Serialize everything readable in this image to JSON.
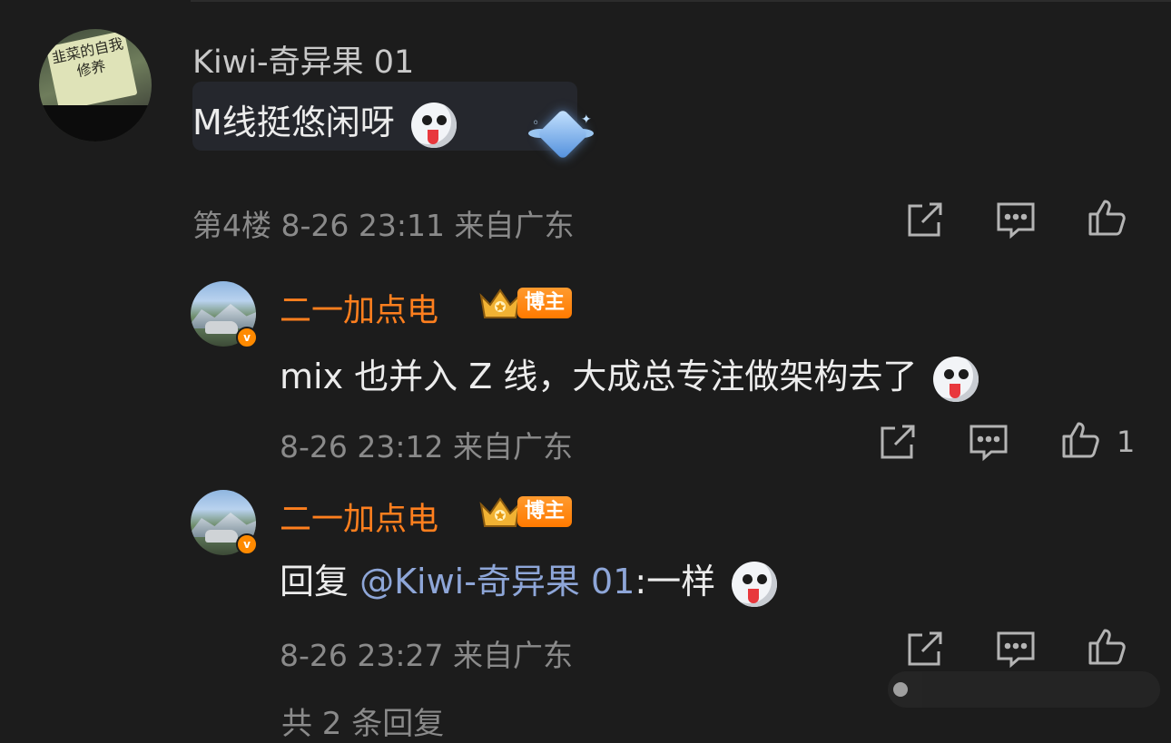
{
  "comment": {
    "username": "Kiwi-奇异果 01",
    "text": "M线挺悠闲呀",
    "floor": "第4楼",
    "time": "8-26 23:11",
    "location": "来自广东",
    "avatar_text": "韭菜的自我修养"
  },
  "replies": [
    {
      "username": "二一加点电",
      "badge": "博主",
      "text": "mix 也并入 Z 线，大成总专注做架构去了",
      "time": "8-26 23:12",
      "location": "来自广东",
      "like_count": "1"
    },
    {
      "username": "二一加点电",
      "badge": "博主",
      "reply_prefix": "回复",
      "mention": "@Kiwi-奇异果 01",
      "text_suffix": ":一样",
      "time": "8-26 23:27",
      "location": "来自广东",
      "like_count": ""
    }
  ],
  "footer": {
    "more_replies": "共 2 条回复"
  },
  "icons": [
    "share-icon",
    "comment-icon",
    "like-icon",
    "emoji-icon",
    "crown-icon",
    "verified-icon"
  ],
  "colors": {
    "background": "#1c1c1c",
    "username_vip": "#ff7f1e",
    "mention": "#8ea6d8",
    "meta": "#8a8a8a"
  }
}
